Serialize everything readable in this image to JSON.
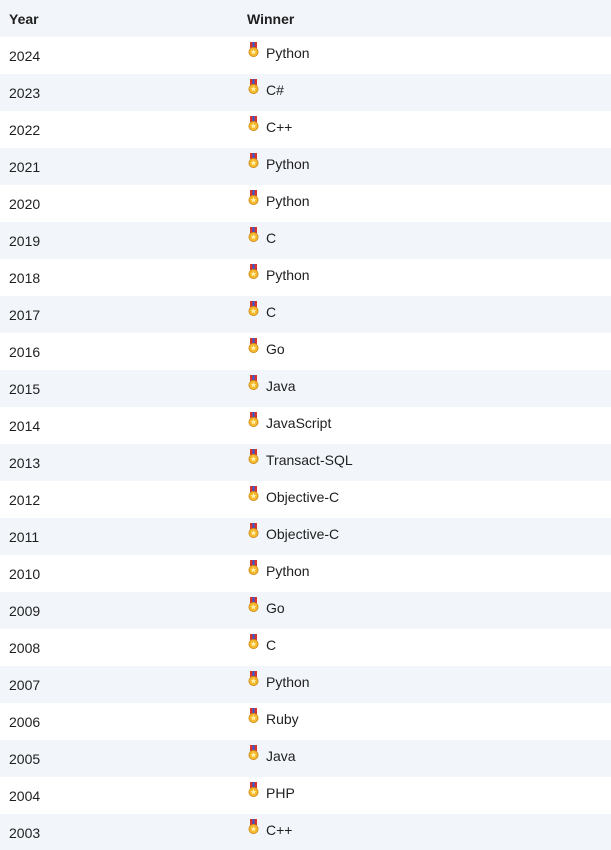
{
  "table": {
    "headers": {
      "year": "Year",
      "winner": "Winner"
    },
    "icon": "medal-icon",
    "colors": {
      "stripe": "#f2f6fa",
      "ribbon": "#d9342b",
      "medal": "#f5b82e"
    },
    "rows": [
      {
        "year": "2024",
        "winner": "Python"
      },
      {
        "year": "2023",
        "winner": "C#"
      },
      {
        "year": "2022",
        "winner": "C++"
      },
      {
        "year": "2021",
        "winner": "Python"
      },
      {
        "year": "2020",
        "winner": "Python"
      },
      {
        "year": "2019",
        "winner": "C"
      },
      {
        "year": "2018",
        "winner": "Python"
      },
      {
        "year": "2017",
        "winner": "C"
      },
      {
        "year": "2016",
        "winner": "Go"
      },
      {
        "year": "2015",
        "winner": "Java"
      },
      {
        "year": "2014",
        "winner": "JavaScript"
      },
      {
        "year": "2013",
        "winner": "Transact-SQL"
      },
      {
        "year": "2012",
        "winner": "Objective-C"
      },
      {
        "year": "2011",
        "winner": "Objective-C"
      },
      {
        "year": "2010",
        "winner": "Python"
      },
      {
        "year": "2009",
        "winner": "Go"
      },
      {
        "year": "2008",
        "winner": "C"
      },
      {
        "year": "2007",
        "winner": "Python"
      },
      {
        "year": "2006",
        "winner": "Ruby"
      },
      {
        "year": "2005",
        "winner": "Java"
      },
      {
        "year": "2004",
        "winner": "PHP"
      },
      {
        "year": "2003",
        "winner": "C++"
      }
    ]
  }
}
